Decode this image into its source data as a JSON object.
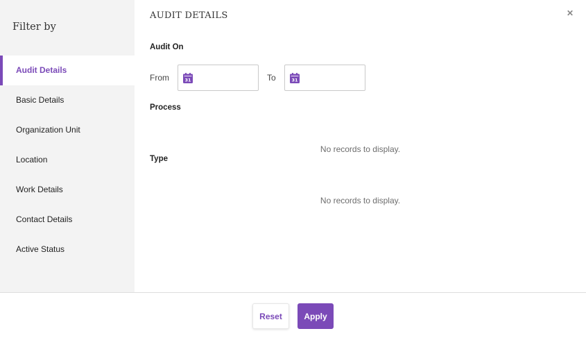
{
  "sidebar": {
    "title": "Filter by",
    "items": [
      {
        "label": "Audit Details",
        "active": true
      },
      {
        "label": "Basic Details",
        "active": false
      },
      {
        "label": "Organization Unit",
        "active": false
      },
      {
        "label": "Location",
        "active": false
      },
      {
        "label": "Work Details",
        "active": false
      },
      {
        "label": "Contact Details",
        "active": false
      },
      {
        "label": "Active Status",
        "active": false
      }
    ]
  },
  "main": {
    "title": "AUDIT DETAILS",
    "close_icon": "close-icon",
    "audit_on": {
      "label": "Audit On",
      "from_label": "From",
      "to_label": "To",
      "from_value": "",
      "to_value": "",
      "calendar_icon": "calendar-icon",
      "calendar_day": "31"
    },
    "process": {
      "label": "Process",
      "empty_text": "No records to display."
    },
    "type": {
      "label": "Type",
      "empty_text": "No records to display."
    }
  },
  "footer": {
    "reset_label": "Reset",
    "apply_label": "Apply"
  },
  "colors": {
    "accent": "#7b4ab8",
    "sidebar_bg": "#f3f3f3"
  }
}
